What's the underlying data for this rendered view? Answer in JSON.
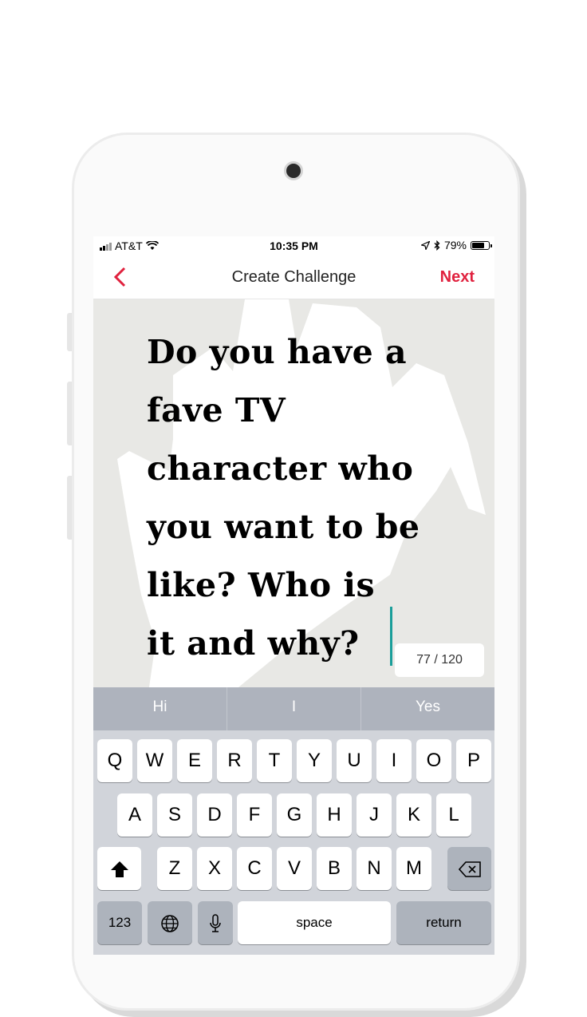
{
  "status_bar": {
    "carrier": "AT&T",
    "time": "10:35 PM",
    "battery_text": "79%",
    "battery_level": 0.79,
    "icons": [
      "signal-icon",
      "wifi-icon",
      "location-arrow-icon",
      "bluetooth-icon",
      "battery-icon"
    ]
  },
  "nav": {
    "back_icon": "chevron-left-icon",
    "title": "Create Challenge",
    "next_label": "Next"
  },
  "editor": {
    "question_lines": [
      "Do you have a",
      "fave TV",
      "character who",
      "you want to be",
      "like?  Who is",
      "it and why?"
    ],
    "char_count": "77 / 120"
  },
  "keyboard": {
    "suggestions": [
      "Hi",
      "I",
      "Yes"
    ],
    "row1": [
      "Q",
      "W",
      "E",
      "R",
      "T",
      "Y",
      "U",
      "I",
      "O",
      "P"
    ],
    "row2": [
      "A",
      "S",
      "D",
      "F",
      "G",
      "H",
      "J",
      "K",
      "L"
    ],
    "row3": [
      "Z",
      "X",
      "C",
      "V",
      "B",
      "N",
      "M"
    ],
    "numbers_key": "123",
    "space_key": "space",
    "return_key": "return",
    "icons": [
      "shift-icon",
      "backspace-icon",
      "globe-icon",
      "microphone-icon"
    ]
  },
  "colors": {
    "accent": "#e0213e",
    "cursor": "#1a9e9a",
    "canvas_bg": "#e8e8e5"
  }
}
